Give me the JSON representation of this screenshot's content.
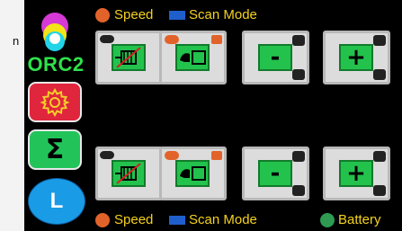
{
  "edge_text": "n",
  "sidebar": {
    "brand": "ORC2",
    "sum_label": "Σ",
    "l_label": "L"
  },
  "status_top": {
    "speed_label": "Speed",
    "scan_label": "Scan Mode"
  },
  "status_bottom": {
    "speed_label": "Speed",
    "scan_label": "Scan Mode",
    "battery_label": "Battery"
  },
  "buttons": {
    "minus_label": "-",
    "plus_label": "+"
  },
  "colors": {
    "panel_bg": "#000000",
    "status_text": "#f5d21f",
    "speed_dot": "#e2632a",
    "scan_rect": "#1f5fcc",
    "battery_dot": "#2f9a52",
    "brand": "#2ee24b",
    "settings_btn": "#e0263c",
    "sum_btn": "#22c45a",
    "l_btn": "#1a9be6"
  },
  "icons": {
    "logo": "rgb-color-circles-icon",
    "settings": "gear-icon",
    "motor_off": "motor-disabled-icon",
    "motor_jog": "motor-jog-icon"
  }
}
